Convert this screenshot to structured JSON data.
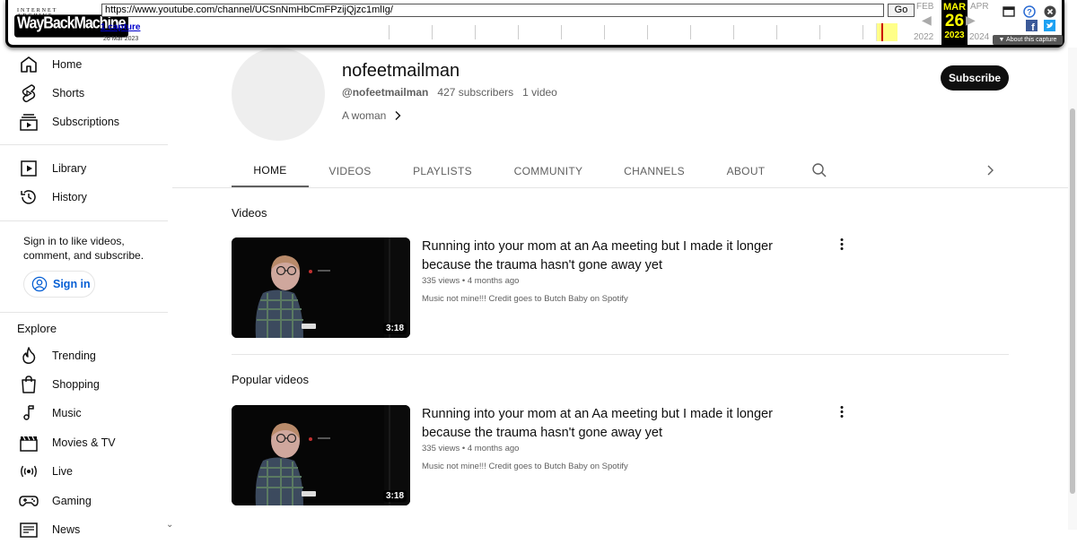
{
  "wayback": {
    "ia_label": "INTERNET ARCHIVE",
    "logo_text": "WayBackMachine",
    "url": "https://www.youtube.com/channel/UCSnNmHbCmFPzijQjzc1mlIg/",
    "go_label": "Go",
    "captures_link": "1 capture",
    "capture_date": "26 Mar 2023",
    "prev_month": "FEB",
    "cur_month": "MAR",
    "next_month": "APR",
    "cur_day": "26",
    "prev_year": "2022",
    "cur_year": "2023",
    "next_year": "2024",
    "about_label": "About this capture",
    "icons": [
      "window-icon",
      "help-icon",
      "close-icon",
      "facebook-icon",
      "twitter-icon"
    ]
  },
  "sidebar": {
    "primary": [
      {
        "label": "Home",
        "icon": "home-icon"
      },
      {
        "label": "Shorts",
        "icon": "shorts-icon"
      },
      {
        "label": "Subscriptions",
        "icon": "subscriptions-icon"
      }
    ],
    "secondary": [
      {
        "label": "Library",
        "icon": "library-icon"
      },
      {
        "label": "History",
        "icon": "history-icon"
      }
    ],
    "signin_prompt": "Sign in to like videos, comment, and subscribe.",
    "signin_label": "Sign in",
    "explore_title": "Explore",
    "explore": [
      {
        "label": "Trending",
        "icon": "trending-icon"
      },
      {
        "label": "Shopping",
        "icon": "shopping-icon"
      },
      {
        "label": "Music",
        "icon": "music-icon"
      },
      {
        "label": "Movies & TV",
        "icon": "movies-icon"
      },
      {
        "label": "Live",
        "icon": "live-icon"
      },
      {
        "label": "Gaming",
        "icon": "gaming-icon"
      },
      {
        "label": "News",
        "icon": "news-icon"
      }
    ]
  },
  "channel": {
    "name": "nofeetmailman",
    "handle": "@nofeetmailman",
    "subscribers": "427 subscribers",
    "video_count": "1 video",
    "about": "A woman",
    "subscribe_label": "Subscribe"
  },
  "tabs": [
    {
      "label": "HOME",
      "active": true
    },
    {
      "label": "VIDEOS",
      "active": false
    },
    {
      "label": "PLAYLISTS",
      "active": false
    },
    {
      "label": "COMMUNITY",
      "active": false
    },
    {
      "label": "CHANNELS",
      "active": false
    },
    {
      "label": "ABOUT",
      "active": false
    }
  ],
  "sections": [
    {
      "title": "Videos",
      "video": {
        "title": "Running into your mom at an Aa meeting but I made it longer because the trauma hasn't gone away yet",
        "views": "335 views",
        "age": "4 months ago",
        "description": "Music not mine!!! Credit goes to Butch Baby on Spotify",
        "duration": "3:18"
      }
    },
    {
      "title": "Popular videos",
      "video": {
        "title": "Running into your mom at an Aa meeting but I made it longer because the trauma hasn't gone away yet",
        "views": "335 views",
        "age": "4 months ago",
        "description": "Music not mine!!! Credit goes to Butch Baby on Spotify",
        "duration": "3:18"
      }
    }
  ]
}
